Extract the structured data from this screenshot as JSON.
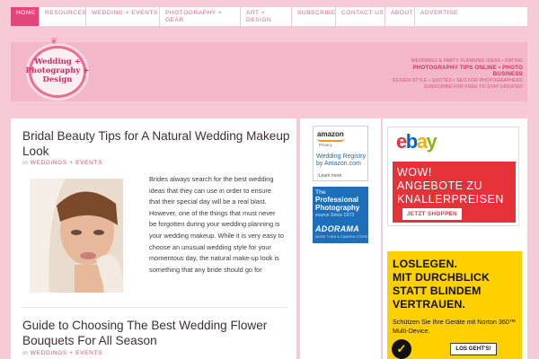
{
  "nav": {
    "items": [
      {
        "label": "Home"
      },
      {
        "label": "Resources"
      },
      {
        "label": "Wedding + Events"
      },
      {
        "label": "Photography + Gear"
      },
      {
        "label": "Art + Design"
      },
      {
        "label": "Subscribe"
      },
      {
        "label": "Contact Us"
      },
      {
        "label": "About"
      },
      {
        "label": "Advertise"
      }
    ]
  },
  "header": {
    "logo_lines": [
      "Wedding +",
      "Photography +",
      "Design"
    ],
    "tagline": {
      "line1": "Weddings & Party Planning Ideas • Dating",
      "line2": "Photography Tips Online • Photo Business",
      "line3": "Design Style • Quotes • SEO for Photographers",
      "line4": "Subscribe for free to stay updated"
    }
  },
  "posts": [
    {
      "title": "Bridal Beauty Tips for A Natural Wedding Makeup Look",
      "meta_prefix": "in",
      "category": "Weddings + Events",
      "excerpt": "Brides always search for the best wedding ideas that they can use in order to ensure that their special day will be a real blast. However, one of the things that must never be forgotten during your wedding planning is your wedding makeup. While it is very easy to choose an unusual wedding style for your momentous day, the natural make-up look is something that any bride should go for"
    },
    {
      "title": "Guide to Choosing The Best Wedding Flower Bouquets For All Season",
      "meta_prefix": "in",
      "category": "Weddings + Events"
    }
  ],
  "ads": {
    "amazon": {
      "brand": "amazon",
      "privacy": "Privacy",
      "text": "Wedding Registry by Amazon.com",
      "learn_more": "›Learn more"
    },
    "adorama": {
      "the": "The",
      "professional": "Professional Photography",
      "source": "source Since 1973",
      "brand": "ADORAMA",
      "small": "MORE THAN A CAMERA STORE"
    },
    "ebay": {
      "logo": [
        "e",
        "b",
        "a",
        "y"
      ],
      "logo_colors": [
        "#e53238",
        "#0064d2",
        "#f5af02",
        "#86b817"
      ],
      "line1": "WOW!",
      "line2": "ANGEBOTE ZU",
      "line3": "KNALLERPREISEN",
      "button": "JETZT SHOPPEN"
    },
    "norton": {
      "headline": [
        "LOSLEGEN.",
        "MIT DURCHBLICK",
        "STATT BLINDEM",
        "VERTRAUEN."
      ],
      "sub": "Schützen Sie Ihre Geräte mit Norton 360™ Multi-Device.",
      "check": "✓",
      "button": "LOS GEHT'S!"
    }
  },
  "colors": {
    "accent": "#e2467a",
    "background": "#f6cbd6",
    "link": "#c75a80"
  }
}
